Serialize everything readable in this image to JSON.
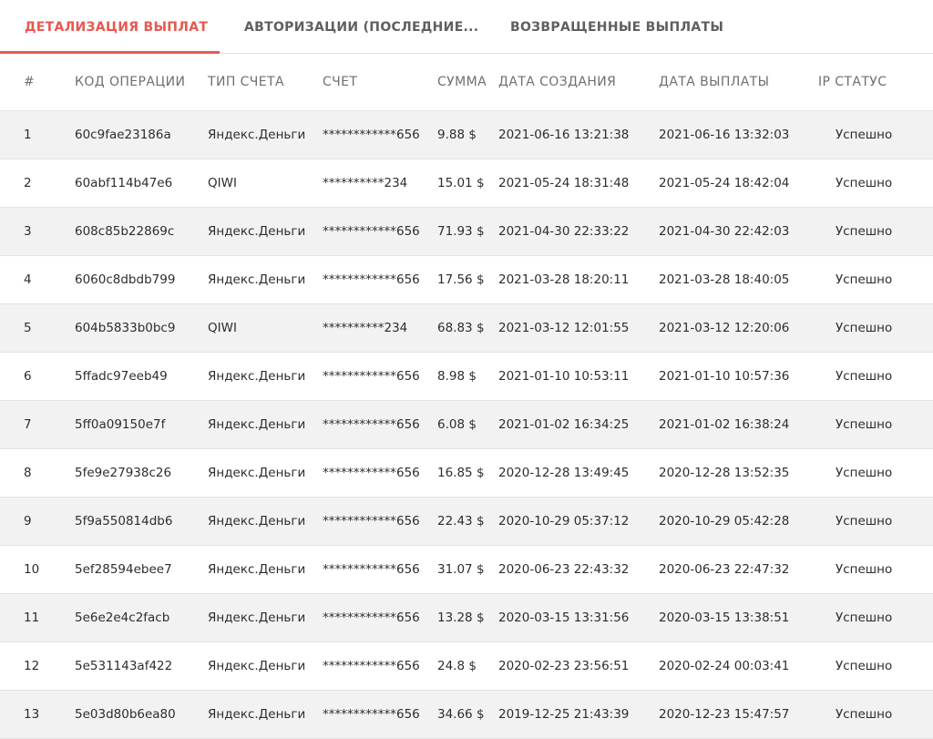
{
  "tabs": [
    {
      "label": "ДЕТАЛИЗАЦИЯ ВЫПЛАТ",
      "active": true
    },
    {
      "label": "АВТОРИЗАЦИИ (ПОСЛЕДНИЕ...",
      "active": false
    },
    {
      "label": "ВОЗВРАЩЕННЫЕ ВЫПЛАТЫ",
      "active": false
    }
  ],
  "table": {
    "columns": [
      "#",
      "КОД ОПЕРАЦИИ",
      "ТИП СЧЕТА",
      "СЧЕТ",
      "СУММА",
      "ДАТА СОЗДАНИЯ",
      "ДАТА ВЫПЛАТЫ",
      "IP СТАТУС"
    ],
    "rows": [
      [
        "1",
        "60c9fae23186a",
        "Яндекс.Деньги",
        "************656",
        "9.88 $",
        "2021-06-16 13:21:38",
        "2021-06-16 13:32:03",
        "Успешно"
      ],
      [
        "2",
        "60abf114b47e6",
        "QIWI",
        "**********234",
        "15.01 $",
        "2021-05-24 18:31:48",
        "2021-05-24 18:42:04",
        "Успешно"
      ],
      [
        "3",
        "608c85b22869c",
        "Яндекс.Деньги",
        "************656",
        "71.93 $",
        "2021-04-30 22:33:22",
        "2021-04-30 22:42:03",
        "Успешно"
      ],
      [
        "4",
        "6060c8dbdb799",
        "Яндекс.Деньги",
        "************656",
        "17.56 $",
        "2021-03-28 18:20:11",
        "2021-03-28 18:40:05",
        "Успешно"
      ],
      [
        "5",
        "604b5833b0bc9",
        "QIWI",
        "**********234",
        "68.83 $",
        "2021-03-12 12:01:55",
        "2021-03-12 12:20:06",
        "Успешно"
      ],
      [
        "6",
        "5ffadc97eeb49",
        "Яндекс.Деньги",
        "************656",
        "8.98 $",
        "2021-01-10 10:53:11",
        "2021-01-10 10:57:36",
        "Успешно"
      ],
      [
        "7",
        "5ff0a09150e7f",
        "Яндекс.Деньги",
        "************656",
        "6.08 $",
        "2021-01-02 16:34:25",
        "2021-01-02 16:38:24",
        "Успешно"
      ],
      [
        "8",
        "5fe9e27938c26",
        "Яндекс.Деньги",
        "************656",
        "16.85 $",
        "2020-12-28 13:49:45",
        "2020-12-28 13:52:35",
        "Успешно"
      ],
      [
        "9",
        "5f9a550814db6",
        "Яндекс.Деньги",
        "************656",
        "22.43 $",
        "2020-10-29 05:37:12",
        "2020-10-29 05:42:28",
        "Успешно"
      ],
      [
        "10",
        "5ef28594ebee7",
        "Яндекс.Деньги",
        "************656",
        "31.07 $",
        "2020-06-23 22:43:32",
        "2020-06-23 22:47:32",
        "Успешно"
      ],
      [
        "11",
        "5e6e2e4c2facb",
        "Яндекс.Деньги",
        "************656",
        "13.28 $",
        "2020-03-15 13:31:56",
        "2020-03-15 13:38:51",
        "Успешно"
      ],
      [
        "12",
        "5e531143af422",
        "Яндекс.Деньги",
        "************656",
        "24.8 $",
        "2020-02-23 23:56:51",
        "2020-02-24 00:03:41",
        "Успешно"
      ],
      [
        "13",
        "5e03d80b6ea80",
        "Яндекс.Деньги",
        "************656",
        "34.66 $",
        "2019-12-25 21:43:39",
        "2020-12-23 15:47:57",
        "Успешно"
      ]
    ]
  },
  "colors": {
    "accent": "#e8584f",
    "row_stripe": "#f2f2f2",
    "border": "#e2e2e2"
  }
}
